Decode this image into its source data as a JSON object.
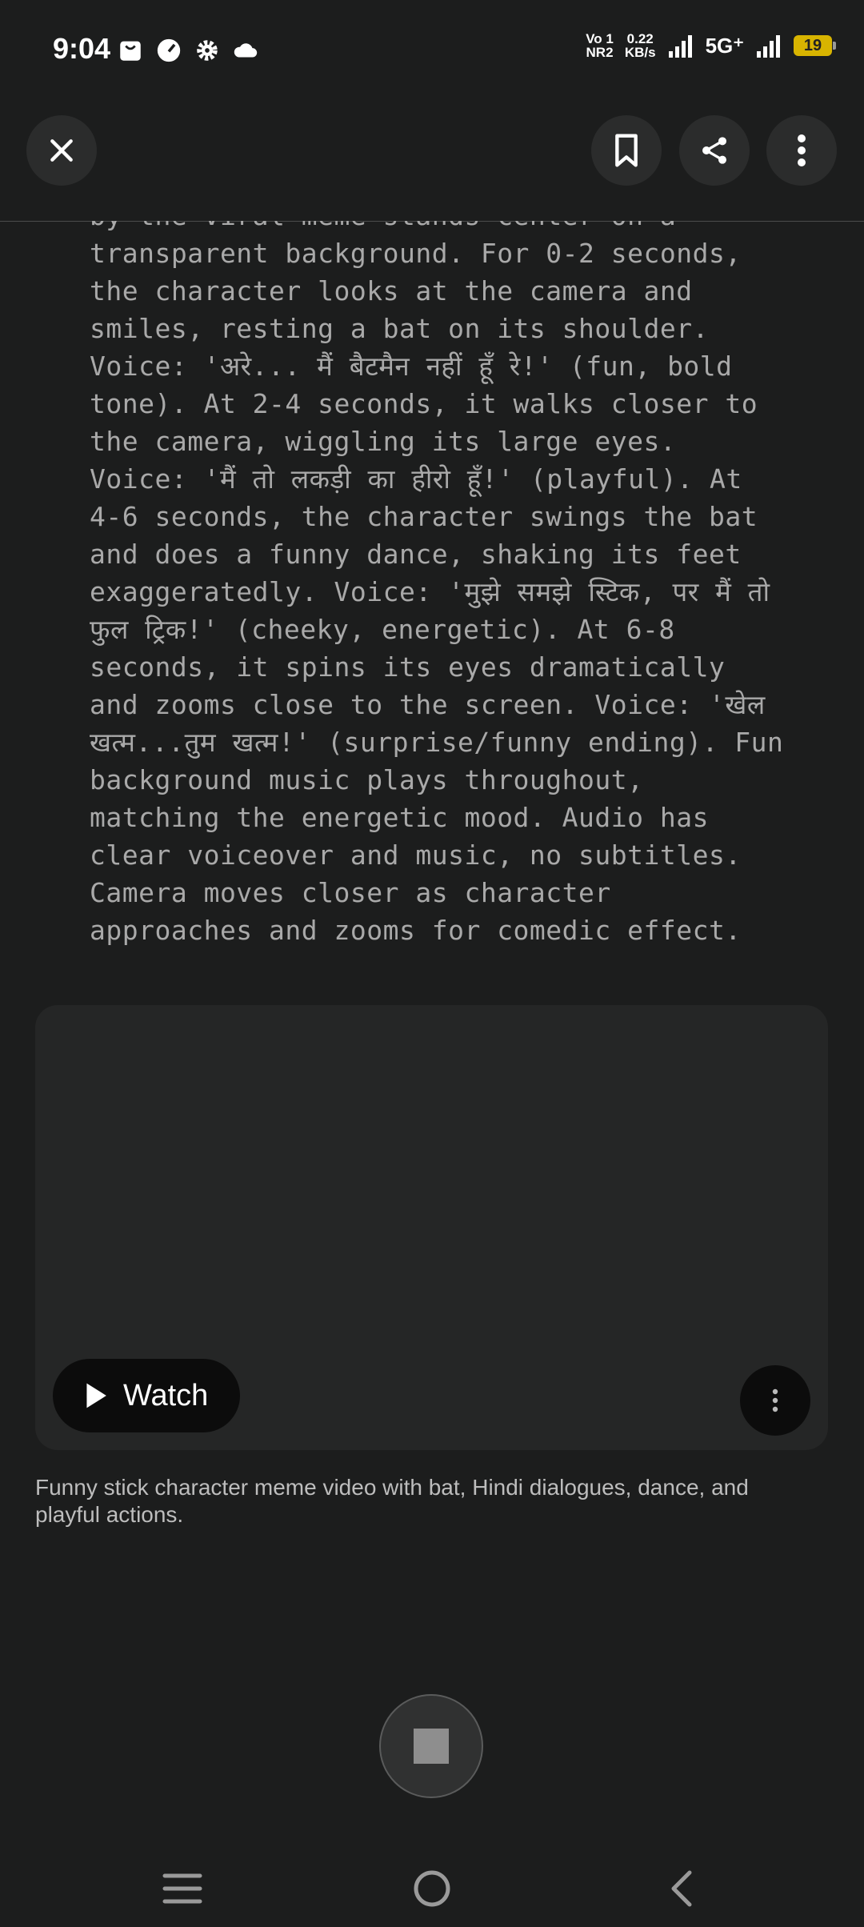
{
  "status_bar": {
    "time": "9:04",
    "volte_line1": "Vo 1",
    "volte_line2": "NR2",
    "speed_value": "0.22",
    "speed_unit": "KB/s",
    "network": "5G⁺",
    "battery": "19",
    "icons": [
      "bag-icon",
      "speedometer-icon",
      "gear-icon",
      "cloud-icon",
      "signal-icon",
      "signal-icon",
      "battery-icon"
    ]
  },
  "toolbar": {
    "icons": [
      "close-icon",
      "bookmark-icon",
      "share-icon",
      "more-vertical-icon"
    ]
  },
  "prompt_text": "by the viral meme stands center on a\ntransparent background. For 0-2 seconds,\nthe character looks at the camera and\nsmiles, resting a bat on its shoulder.\nVoice: 'अरे... मैं बैटमैन नहीं हूँ रे!' (fun, bold\ntone). At 2-4 seconds, it walks closer to\nthe camera, wiggling its large eyes.\nVoice: 'मैं तो लकड़ी का हीरो हूँ!' (playful). At\n4-6 seconds, the character swings the bat\nand does a funny dance, shaking its feet\nexaggeratedly. Voice: 'मुझे समझे स्टिक, पर मैं तो\nफुल ट्रिक!' (cheeky, energetic). At 6-8\nseconds, it spins its eyes dramatically\nand zooms close to the screen. Voice: 'खेल\nखत्म...तुम खत्म!' (surprise/funny ending). Fun\nbackground music plays throughout,\nmatching the energetic mood. Audio has\nclear voiceover and music, no subtitles.\nCamera moves closer as character\napproaches and zooms for comedic effect.",
  "video_card": {
    "watch_label": "Watch",
    "caption": "Funny stick character meme video with bat, Hindi dialogues, dance, and playful actions."
  },
  "colors": {
    "background": "#1c1d1d",
    "card": "#252626",
    "body_text": "#a9a9a9",
    "battery": "#d8b400"
  }
}
